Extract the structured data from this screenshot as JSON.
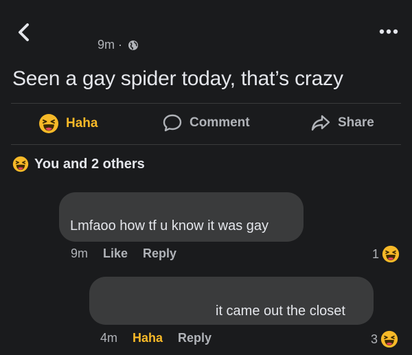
{
  "header": {
    "time": "9m",
    "separator": "·"
  },
  "post": {
    "text": "Seen a gay spider today, that’s crazy"
  },
  "actions": {
    "haha": "Haha",
    "comment": "Comment",
    "share": "Share"
  },
  "reactions": {
    "summary": "You and 2 others"
  },
  "comments": [
    {
      "text": "Lmfaoo how tf u know it was gay",
      "time": "9m",
      "like": "Like",
      "reply": "Reply",
      "reaction_count": "1"
    },
    {
      "text": "it came out the closet",
      "time": "4m",
      "like": "Haha",
      "reply": "Reply",
      "reaction_count": "3"
    }
  ],
  "colors": {
    "background": "#1a1b1d",
    "bubble": "#3a3b3c",
    "text": "#e4e6eb",
    "muted": "#b0b3b8",
    "haha": "#f7b928"
  },
  "icons": [
    "back-chevron-icon",
    "more-dots-icon",
    "globe-icon",
    "haha-emoji-icon",
    "comment-icon",
    "share-icon"
  ]
}
